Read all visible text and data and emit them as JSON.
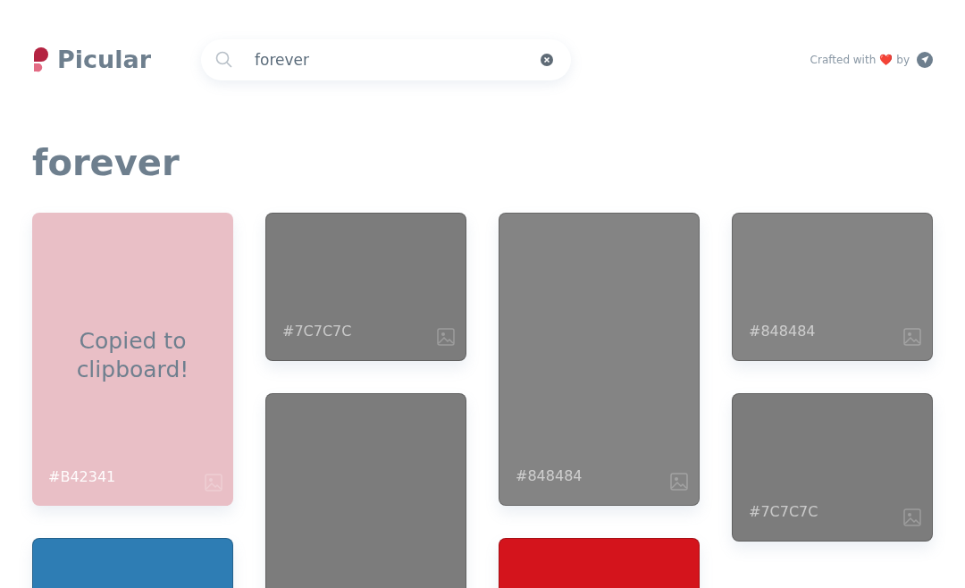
{
  "logo": {
    "text": "Picular"
  },
  "search": {
    "value": "forever"
  },
  "credit": {
    "text": "Crafted with",
    "heart": "❤️",
    "by": "by"
  },
  "title": "forever",
  "columns": [
    {
      "cards": [
        {
          "kind": "tall",
          "color": "#e9bfc6",
          "hex": "#B42341",
          "copied": true,
          "message": "Copied to clipboard!"
        },
        {
          "kind": "tall",
          "color": "#2e7db4",
          "copied": false
        }
      ]
    },
    {
      "cards": [
        {
          "kind": "short",
          "color": "#7c7c7c",
          "hex": "#7C7C7C",
          "copied": false
        },
        {
          "kind": "tall",
          "color": "#7c7c7c",
          "copied": false
        }
      ]
    },
    {
      "cards": [
        {
          "kind": "tall",
          "color": "#848484",
          "hex": "#848484",
          "copied": false
        },
        {
          "kind": "tall",
          "color": "#d4141c",
          "copied": false
        }
      ]
    },
    {
      "cards": [
        {
          "kind": "short",
          "color": "#848484",
          "hex": "#848484",
          "copied": false
        },
        {
          "kind": "short",
          "color": "#7c7c7c",
          "hex": "#7C7C7C",
          "copied": false
        }
      ]
    }
  ]
}
